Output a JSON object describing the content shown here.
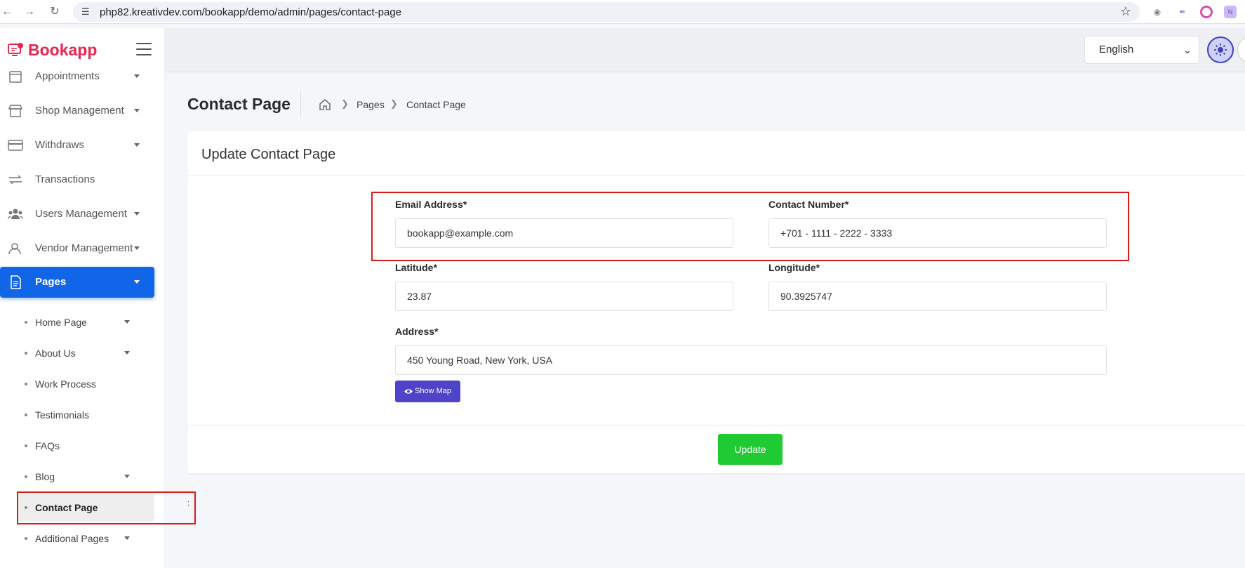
{
  "browser": {
    "url": "php82.kreativdev.com/bookapp/demo/admin/pages/contact-page"
  },
  "brand": {
    "name": "Bookapp"
  },
  "sidebar": {
    "items": [
      {
        "label": "Appointments",
        "icon": "calendar-icon",
        "has_caret": true
      },
      {
        "label": "Shop Management",
        "icon": "store-icon",
        "has_caret": true
      },
      {
        "label": "Withdraws",
        "icon": "credit-card-icon",
        "has_caret": true
      },
      {
        "label": "Transactions",
        "icon": "transfer-icon",
        "has_caret": false
      },
      {
        "label": "Users Management",
        "icon": "users-icon",
        "has_caret": true
      },
      {
        "label": "Vendor Management",
        "icon": "vendor-icon",
        "has_caret": true
      },
      {
        "label": "Pages",
        "icon": "document-icon",
        "has_caret": true,
        "active": true
      }
    ],
    "sub_items": [
      {
        "label": "Home Page",
        "has_caret": true
      },
      {
        "label": "About Us",
        "has_caret": true
      },
      {
        "label": "Work Process",
        "has_caret": false
      },
      {
        "label": "Testimonials",
        "has_caret": false
      },
      {
        "label": "FAQs",
        "has_caret": false
      },
      {
        "label": "Blog",
        "has_caret": true
      },
      {
        "label": "Contact Page",
        "has_caret": false,
        "active": true
      },
      {
        "label": "Additional Pages",
        "has_caret": true
      }
    ]
  },
  "topbar": {
    "language": "English"
  },
  "header": {
    "title": "Contact Page",
    "breadcrumb": [
      "Pages",
      "Contact Page"
    ]
  },
  "form": {
    "card_title": "Update Contact Page",
    "email_label": "Email Address*",
    "email_value": "bookapp@example.com",
    "contact_label": "Contact Number*",
    "contact_value": "+701 - 1111 - 2222 - 3333",
    "latitude_label": "Latitude*",
    "latitude_value": "23.87",
    "longitude_label": "Longitude*",
    "longitude_value": "90.3925747",
    "address_label": "Address*",
    "address_value": "450 Young Road, New York, USA",
    "show_map_label": "Show Map",
    "update_label": "Update"
  },
  "colors": {
    "brand": "#e8264f",
    "active_menu": "#1166e8",
    "show_map": "#4f44c9",
    "update": "#1fca33",
    "highlight": "#e01818"
  }
}
